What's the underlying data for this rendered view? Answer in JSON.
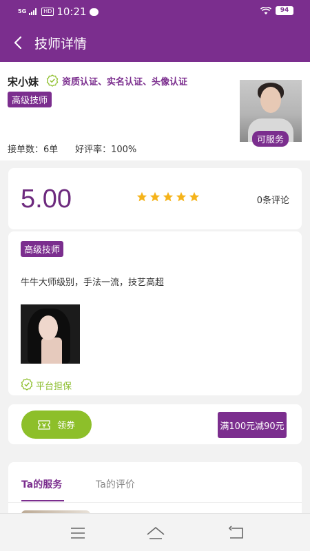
{
  "status_bar": {
    "signal": "5G",
    "hd": "HD",
    "time": "10:21",
    "battery": "94"
  },
  "header": {
    "title": "技师详情"
  },
  "profile": {
    "name": "宋小妹",
    "verifications": "资质认证、实名认证、头像认证",
    "level": "高级技师",
    "stats": "接单数：6单      好评率：100%",
    "availability": "可服务"
  },
  "rating": {
    "score": "5.00",
    "stars": 5,
    "review_count": "0条评论"
  },
  "intro": {
    "level": "高级技师",
    "description": "牛牛大师级别，手法一流，技艺高超",
    "guarantee": "平台担保"
  },
  "coupon": {
    "button_label": "领券",
    "discount": "满100元减90元"
  },
  "tabs": [
    {
      "label": "Ta的服务"
    },
    {
      "label": "Ta的评价"
    }
  ],
  "colors": {
    "brand": "#7b2e8e",
    "accent_green": "#8dbf2a",
    "star": "#f5b31a"
  },
  "icons": {
    "back": "back-arrow-icon",
    "verify": "verified-check-icon",
    "coupon": "ticket-icon",
    "menu": "menu-icon",
    "home": "home-icon",
    "return": "return-icon"
  }
}
